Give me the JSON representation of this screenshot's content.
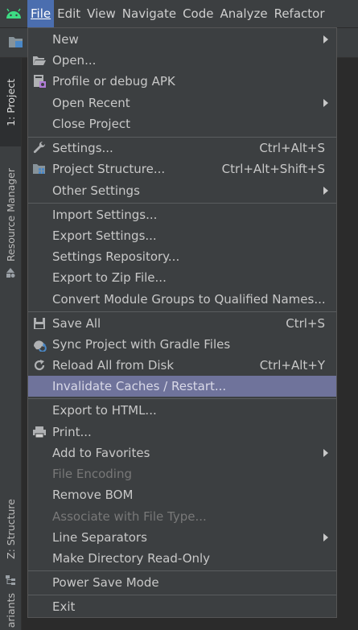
{
  "menubar": {
    "items": [
      {
        "label": "File",
        "active": true
      },
      {
        "label": "Edit"
      },
      {
        "label": "View"
      },
      {
        "label": "Navigate"
      },
      {
        "label": "Code"
      },
      {
        "label": "Analyze"
      },
      {
        "label": "Refactor"
      }
    ]
  },
  "left_tabs": {
    "project": "1: Project",
    "resource_manager": "Resource Manager",
    "structure": "Z: Structure",
    "variants": "ariants"
  },
  "file_menu": {
    "new": "New",
    "open": "Open...",
    "profile_debug_apk": "Profile or debug APK",
    "open_recent": "Open Recent",
    "close_project": "Close Project",
    "settings": "Settings...",
    "settings_shortcut": "Ctrl+Alt+S",
    "project_structure": "Project Structure...",
    "project_structure_shortcut": "Ctrl+Alt+Shift+S",
    "other_settings": "Other Settings",
    "import_settings": "Import Settings...",
    "export_settings": "Export Settings...",
    "settings_repository": "Settings Repository...",
    "export_zip": "Export to Zip File...",
    "convert_module_groups": "Convert Module Groups to Qualified Names...",
    "save_all": "Save All",
    "save_all_shortcut": "Ctrl+S",
    "sync_gradle": "Sync Project with Gradle Files",
    "reload_disk": "Reload All from Disk",
    "reload_disk_shortcut": "Ctrl+Alt+Y",
    "invalidate_caches": "Invalidate Caches / Restart...",
    "export_html": "Export to HTML...",
    "print": "Print...",
    "add_favorites": "Add to Favorites",
    "file_encoding": "File Encoding",
    "remove_bom": "Remove BOM",
    "associate_file_type": "Associate with File Type...",
    "line_separators": "Line Separators",
    "make_read_only": "Make Directory Read-Only",
    "power_save_mode": "Power Save Mode",
    "exit": "Exit"
  },
  "colors": {
    "menu_bg": "#3c3f41",
    "selected_row": "#6f739b",
    "active_menu": "#4b6eaf",
    "android_green": "#3ddc84"
  }
}
